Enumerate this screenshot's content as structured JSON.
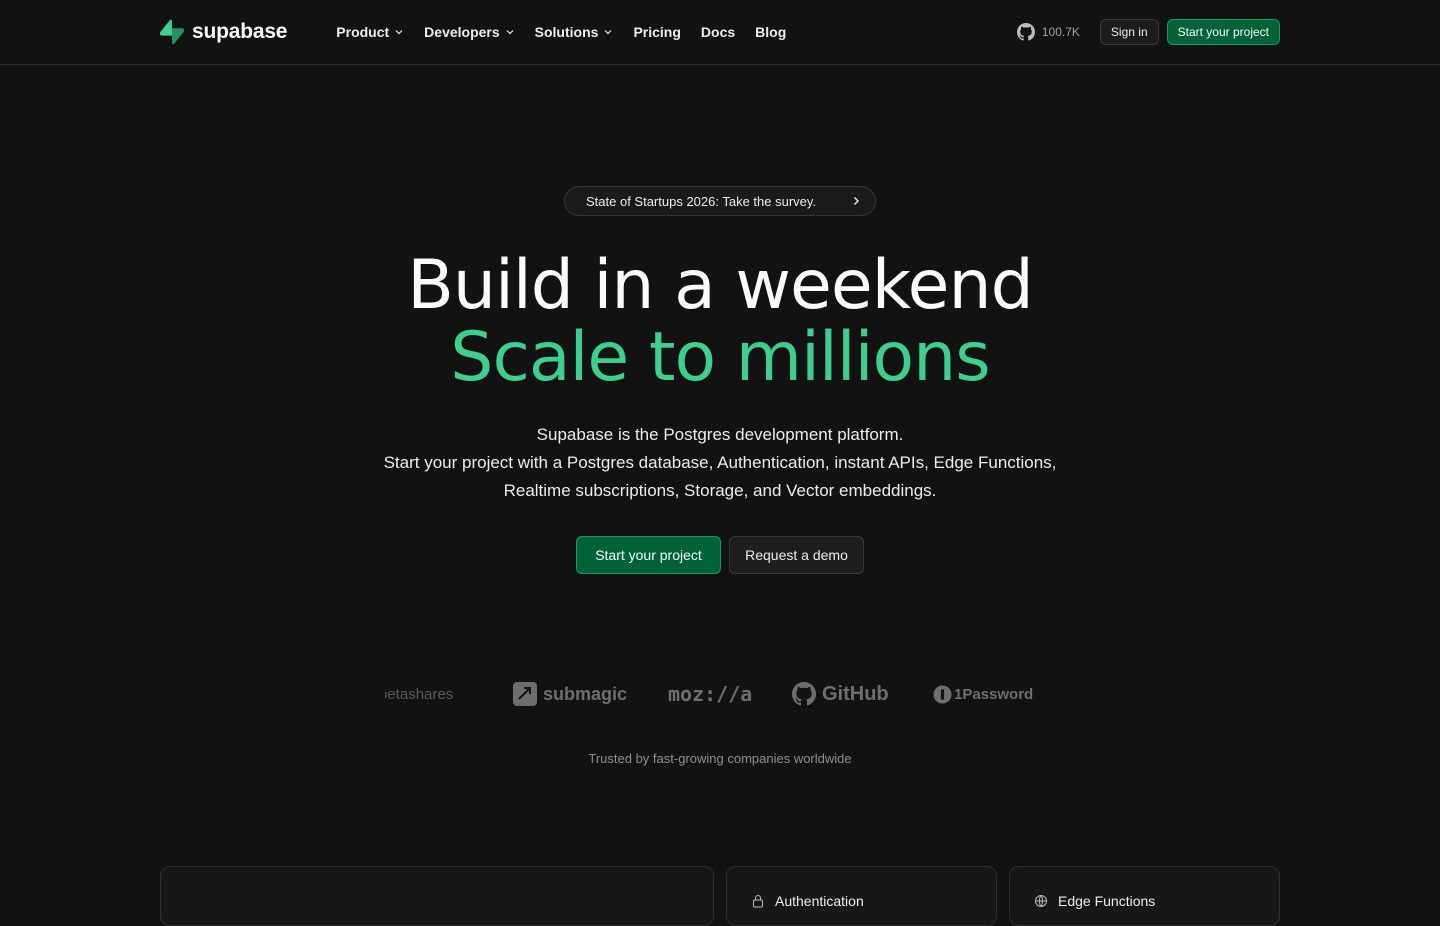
{
  "brand": {
    "name": "supabase",
    "accent_color": "#3ecf8e",
    "button_green": "#006239",
    "background": "#121212"
  },
  "nav": {
    "items": [
      {
        "label": "Product",
        "has_dropdown": true
      },
      {
        "label": "Developers",
        "has_dropdown": true
      },
      {
        "label": "Solutions",
        "has_dropdown": true
      },
      {
        "label": "Pricing",
        "has_dropdown": false
      },
      {
        "label": "Docs",
        "has_dropdown": false
      },
      {
        "label": "Blog",
        "has_dropdown": false
      }
    ],
    "github_icon": "github-icon",
    "github_stars": "100.7K",
    "sign_in_label": "Sign in",
    "start_project_label": "Start your project"
  },
  "hero": {
    "announcement": "State of Startups 2026: Take the survey.",
    "headline_line1": "Build in a weekend",
    "headline_line2": "Scale to millions",
    "subtitle_line1": "Supabase is the Postgres development platform.",
    "subtitle_line2": "Start your project with a Postgres database, Authentication, instant APIs, Edge Functions, Realtime subscriptions, Storage, and Vector embeddings.",
    "cta_primary": "Start your project",
    "cta_secondary": "Request a demo"
  },
  "customers": {
    "logos": [
      "betashares",
      "submagic",
      "moz://a",
      "GitHub",
      "1Password"
    ],
    "caption": "Trusted by fast-growing companies worldwide"
  },
  "feature_cards": [
    {
      "title": ""
    },
    {
      "title": "Authentication",
      "icon": "lock-icon"
    },
    {
      "title": "Edge Functions",
      "icon": "globe-icon"
    }
  ]
}
